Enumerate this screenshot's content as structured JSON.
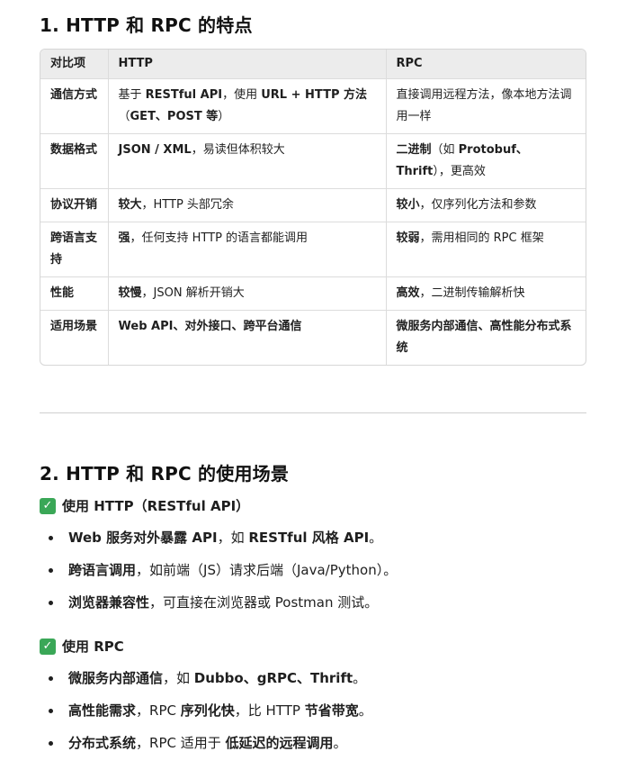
{
  "section1": {
    "title": "1. HTTP 和 RPC 的特点",
    "headers": [
      "对比项",
      "HTTP",
      "RPC"
    ],
    "rows": [
      {
        "label": "通信方式",
        "http": [
          {
            "t": "基于 "
          },
          {
            "t": "RESTful API",
            "b": true
          },
          {
            "t": "，使用 "
          },
          {
            "t": "URL + HTTP 方法",
            "b": true
          },
          {
            "t": "（"
          },
          {
            "t": "GET、POST 等",
            "b": true
          },
          {
            "t": "）"
          }
        ],
        "rpc": [
          {
            "t": "直接调用远程方法，像本地方法调用一样"
          }
        ]
      },
      {
        "label": "数据格式",
        "http": [
          {
            "t": "JSON / XML",
            "b": true
          },
          {
            "t": "，易读但体积较大"
          }
        ],
        "rpc": [
          {
            "t": "二进制",
            "b": true
          },
          {
            "t": "（如 "
          },
          {
            "t": "Protobuf、Thrift",
            "b": true
          },
          {
            "t": "），更高效"
          }
        ]
      },
      {
        "label": "协议开销",
        "http": [
          {
            "t": "较大",
            "b": true
          },
          {
            "t": "，HTTP 头部冗余"
          }
        ],
        "rpc": [
          {
            "t": "较小",
            "b": true
          },
          {
            "t": "，仅序列化方法和参数"
          }
        ]
      },
      {
        "label": "跨语言支持",
        "http": [
          {
            "t": "强",
            "b": true
          },
          {
            "t": "，任何支持 HTTP 的语言都能调用"
          }
        ],
        "rpc": [
          {
            "t": "较弱",
            "b": true
          },
          {
            "t": "，需用相同的 RPC 框架"
          }
        ]
      },
      {
        "label": "性能",
        "http": [
          {
            "t": "较慢",
            "b": true
          },
          {
            "t": "，JSON 解析开销大"
          }
        ],
        "rpc": [
          {
            "t": "高效",
            "b": true
          },
          {
            "t": "，二进制传输解析快"
          }
        ]
      },
      {
        "label": "适用场景",
        "http": [
          {
            "t": "Web API、对外接口、跨平台通信",
            "b": true
          }
        ],
        "rpc": [
          {
            "t": "微服务内部通信、高性能分布式系统",
            "b": true
          }
        ]
      }
    ]
  },
  "section2": {
    "title": "2. HTTP 和 RPC 的使用场景",
    "groups": [
      {
        "icon": "check-mark-icon",
        "heading": "使用 HTTP（RESTful API）",
        "items": [
          [
            {
              "t": "Web 服务对外暴露 API",
              "b": true
            },
            {
              "t": "，如 "
            },
            {
              "t": "RESTful 风格 API",
              "b": true
            },
            {
              "t": "。"
            }
          ],
          [
            {
              "t": "跨语言调用",
              "b": true
            },
            {
              "t": "，如前端（JS）请求后端（Java/Python）。"
            }
          ],
          [
            {
              "t": "浏览器兼容性",
              "b": true
            },
            {
              "t": "，可直接在浏览器或 Postman 测试。"
            }
          ]
        ]
      },
      {
        "icon": "check-mark-icon",
        "heading": "使用 RPC",
        "items": [
          [
            {
              "t": "微服务内部通信",
              "b": true
            },
            {
              "t": "，如 "
            },
            {
              "t": "Dubbo、gRPC、Thrift",
              "b": true
            },
            {
              "t": "。"
            }
          ],
          [
            {
              "t": "高性能需求",
              "b": true
            },
            {
              "t": "，RPC "
            },
            {
              "t": "序列化快",
              "b": true
            },
            {
              "t": "，比 HTTP "
            },
            {
              "t": "节省带宽",
              "b": true
            },
            {
              "t": "。"
            }
          ],
          [
            {
              "t": "分布式系统",
              "b": true
            },
            {
              "t": "，RPC 适用于 "
            },
            {
              "t": "低延迟的远程调用",
              "b": true
            },
            {
              "t": "。"
            }
          ]
        ]
      }
    ]
  },
  "colors": {
    "check_bg": "#3aa757",
    "header_bg": "#ececec",
    "border": "#d6d6d6"
  }
}
